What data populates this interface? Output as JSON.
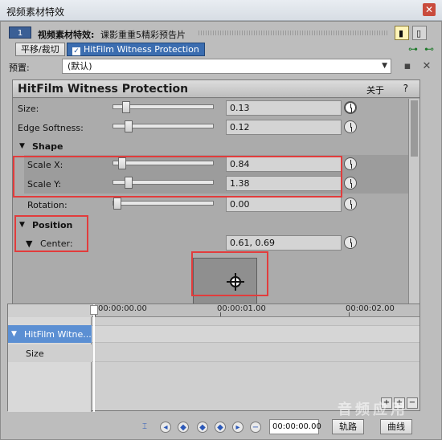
{
  "window": {
    "title": "视频素材特效",
    "close_label": "✕"
  },
  "header": {
    "chip": "1",
    "title": "视频素材特效:",
    "subtitle": "课影重重5精彩预告片",
    "view_btn_a": "▮",
    "view_btn_b": "▯"
  },
  "chain": {
    "items": [
      {
        "label": "平移/裁切"
      },
      {
        "label": "HitFilm Witness Protection",
        "checked": "✓"
      }
    ],
    "plug_a": "⊶",
    "plug_b": "⊷"
  },
  "preset": {
    "label": "预置:",
    "value": "(默认)",
    "arrow": "▼",
    "save_icon": "▪",
    "delete_icon": "✕"
  },
  "plugin": {
    "title": "HitFilm Witness Protection",
    "about": "关于",
    "help": "?",
    "rows": {
      "size": {
        "label": "Size:",
        "value": "0.13",
        "level": 0.1
      },
      "edge_softness": {
        "label": "Edge Softness:",
        "value": "0.12",
        "level": 0.12
      },
      "shape_group": "Shape",
      "scale_x": {
        "label": "Scale X:",
        "value": "0.84",
        "level": 0.05
      },
      "scale_y": {
        "label": "Scale Y:",
        "value": "1.38",
        "level": 0.12
      },
      "rotation": {
        "label": "Rotation:",
        "value": "0.00",
        "level": 0.0
      },
      "position_group": "Position",
      "center": {
        "label": "Center:",
        "value": "0.61, 0.69"
      }
    }
  },
  "timeline": {
    "ticks": [
      "00:00:00.00",
      "00:00:01.00",
      "00:00:02.00"
    ],
    "tracks": [
      {
        "label": "HitFilm Witne..."
      },
      {
        "label": "Size"
      }
    ],
    "zoom_plus": "+",
    "zoom_minus": "−"
  },
  "bottom": {
    "timecode": "00:00:00.00",
    "btn_tracks": "轨路",
    "btn_curves": "曲线",
    "watermark": "音频应用"
  }
}
